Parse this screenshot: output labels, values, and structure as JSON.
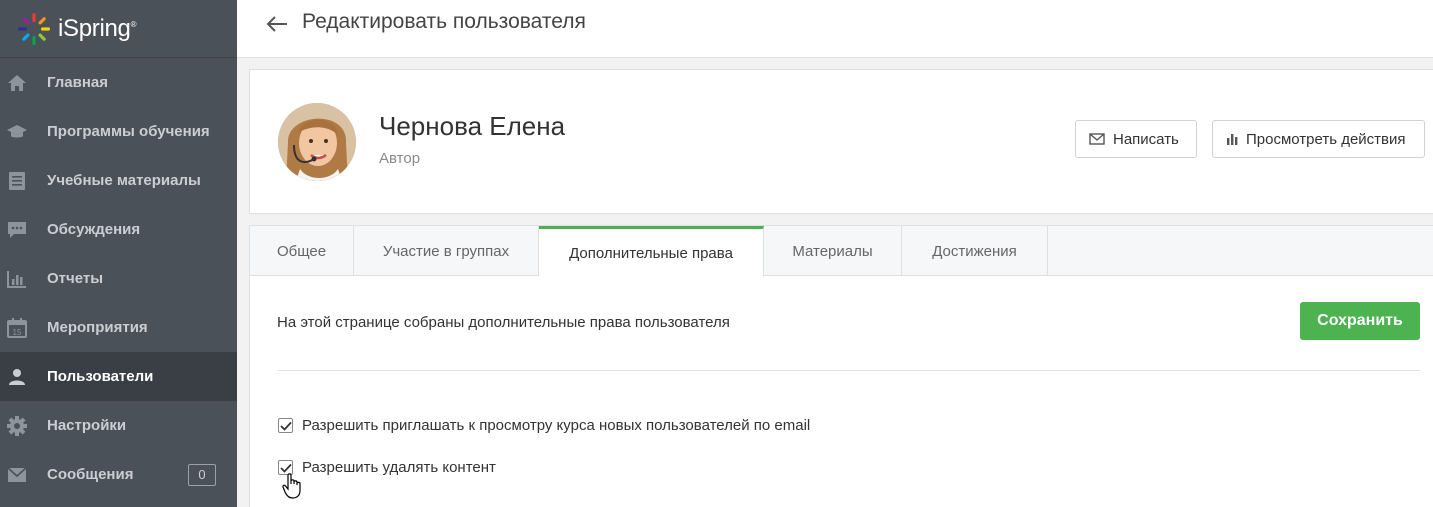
{
  "app": {
    "logo_text": "iSpring"
  },
  "sidebar": {
    "items": [
      {
        "label": "Главная",
        "icon": "home-icon"
      },
      {
        "label": "Программы обучения",
        "icon": "graduation-cap-icon"
      },
      {
        "label": "Учебные материалы",
        "icon": "document-list-icon"
      },
      {
        "label": "Обсуждения",
        "icon": "chat-bubble-icon"
      },
      {
        "label": "Отчеты",
        "icon": "bar-chart-icon"
      },
      {
        "label": "Мероприятия",
        "icon": "calendar-icon"
      },
      {
        "label": "Пользователи",
        "icon": "user-icon",
        "active": true
      },
      {
        "label": "Настройки",
        "icon": "gear-icon"
      },
      {
        "label": "Сообщения",
        "icon": "envelope-icon",
        "badge": "0"
      }
    ]
  },
  "header": {
    "title": "Редактировать пользователя"
  },
  "profile": {
    "name": "Чернова Елена",
    "role": "Автор",
    "write_button": "Написать",
    "view_actions_button": "Просмотреть действия"
  },
  "tabs": [
    {
      "label": "Общее"
    },
    {
      "label": "Участие в группах"
    },
    {
      "label": "Дополнительные права",
      "active": true
    },
    {
      "label": "Материалы"
    },
    {
      "label": "Достижения"
    }
  ],
  "content": {
    "description": "На этой странице собраны дополнительные права пользователя",
    "save_button": "Сохранить",
    "permissions": [
      {
        "label": "Разрешить приглашать к просмотру курса новых пользователей по email",
        "checked": true
      },
      {
        "label": "Разрешить удалять контент",
        "checked": true
      }
    ]
  },
  "colors": {
    "sidebar_bg": "#4a5158",
    "sidebar_active": "#3a3f45",
    "accent_green": "#4cb350"
  }
}
